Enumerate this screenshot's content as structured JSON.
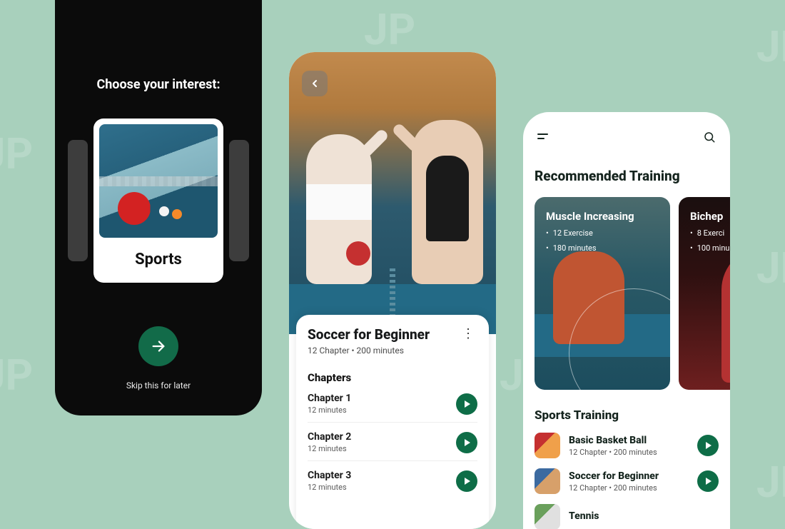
{
  "screen1": {
    "title": "Choose your interest:",
    "card_label": "Sports",
    "skip": "Skip this for later"
  },
  "screen2": {
    "course_title": "Soccer for Beginner",
    "course_sub": "12 Chapter • 200 minutes",
    "chapters_label": "Chapters",
    "chapters": [
      {
        "name": "Chapter 1",
        "duration": "12 minutes"
      },
      {
        "name": "Chapter 2",
        "duration": "12 minutes"
      },
      {
        "name": "Chapter 3",
        "duration": "12 minutes"
      }
    ]
  },
  "screen3": {
    "reco_header": "Recommended Training",
    "reco": [
      {
        "title": "Muscle Increasing",
        "l1": "12 Exercise",
        "l2": "180 minutes"
      },
      {
        "title": "Bichep",
        "l1": "8 Exerci",
        "l2": "100 minu"
      }
    ],
    "sports_header": "Sports Training",
    "list": [
      {
        "title": "Basic Basket Ball",
        "sub": "12 Chapter • 200 minutes"
      },
      {
        "title": "Soccer for Beginner",
        "sub": "12 Chapter • 200 minutes"
      },
      {
        "title": "Tennis",
        "sub": ""
      }
    ]
  }
}
